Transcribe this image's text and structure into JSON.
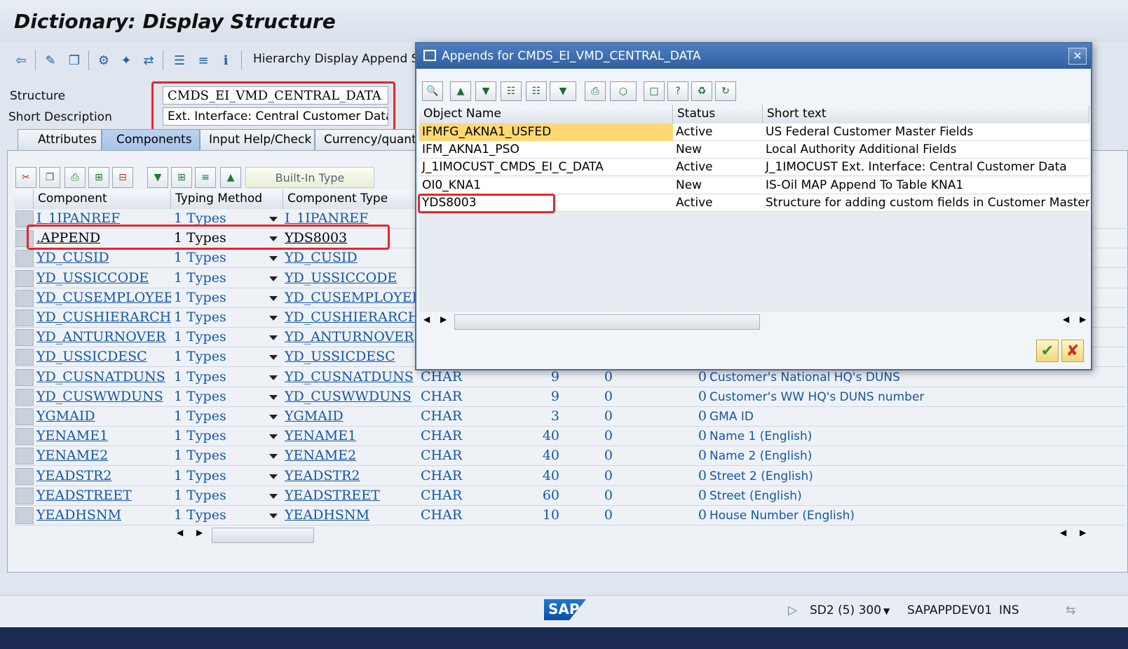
{
  "window": {
    "title": "Dictionary: Display Structure"
  },
  "toolbar": {
    "hierarchy_display": "Hierarchy Display",
    "append_structures": "Append S"
  },
  "header": {
    "structure_label": "Structure",
    "structure_value": "CMDS_EI_VMD_CENTRAL_DATA",
    "short_desc_label": "Short Description",
    "short_desc_value": "Ext. Interface: Central Customer Data"
  },
  "tabs": [
    "Attributes",
    "Components",
    "Input Help/Check",
    "Currency/quantit"
  ],
  "table_toolbar": {
    "builtin_type": "Built-In Type"
  },
  "grid": {
    "columns": [
      "Component",
      "Typing Method",
      "Component Type"
    ],
    "rows": [
      {
        "component": "I_1IPANREF",
        "typing": "1 Types",
        "ctype": "I_1IPANREF",
        "dtype": "",
        "length": "",
        "dec": "",
        "short": "",
        "desc": ""
      },
      {
        "component": ".APPEND",
        "typing": "1 Types",
        "ctype": "YDS8003",
        "dtype": "",
        "length": "",
        "dec": "",
        "short": "",
        "desc": ""
      },
      {
        "component": "YD_CUSID",
        "typing": "1 Types",
        "ctype": "YD_CUSID",
        "dtype": "",
        "length": "",
        "dec": "",
        "short": "",
        "desc": ""
      },
      {
        "component": "YD_USSICCODE",
        "typing": "1 Types",
        "ctype": "YD_USSICCODE",
        "dtype": "",
        "length": "",
        "dec": "",
        "short": "",
        "desc": ""
      },
      {
        "component": "YD_CUSEMPLOYEE",
        "typing": "1 Types",
        "ctype": "YD_CUSEMPLOYEE",
        "dtype": "",
        "length": "",
        "dec": "",
        "short": "",
        "desc": ""
      },
      {
        "component": "YD_CUSHIERARCHY",
        "typing": "1 Types",
        "ctype": "YD_CUSHIERARCHY",
        "dtype": "",
        "length": "",
        "dec": "",
        "short": "",
        "desc": ""
      },
      {
        "component": "YD_ANTURNOVER",
        "typing": "1 Types",
        "ctype": "YD_ANTURNOVER",
        "dtype": "",
        "length": "",
        "dec": "",
        "short": "",
        "desc": ""
      },
      {
        "component": "YD_USSICDESC",
        "typing": "1 Types",
        "ctype": "YD_USSICDESC",
        "dtype": "",
        "length": "",
        "dec": "",
        "short": "",
        "desc": ""
      },
      {
        "component": "YD_CUSNATDUNS",
        "typing": "1 Types",
        "ctype": "YD_CUSNATDUNS",
        "dtype": "CHAR",
        "length": "9",
        "dec": "0",
        "short": "0",
        "desc": "Customer's National HQ's DUNS"
      },
      {
        "component": "YD_CUSWWDUNS",
        "typing": "1 Types",
        "ctype": "YD_CUSWWDUNS",
        "dtype": "CHAR",
        "length": "9",
        "dec": "0",
        "short": "0",
        "desc": "Customer's WW HQ's DUNS number"
      },
      {
        "component": "YGMAID",
        "typing": "1 Types",
        "ctype": "YGMAID",
        "dtype": "CHAR",
        "length": "3",
        "dec": "0",
        "short": "0",
        "desc": "GMA ID"
      },
      {
        "component": "YENAME1",
        "typing": "1 Types",
        "ctype": "YENAME1",
        "dtype": "CHAR",
        "length": "40",
        "dec": "0",
        "short": "0",
        "desc": "Name 1 (English)"
      },
      {
        "component": "YENAME2",
        "typing": "1 Types",
        "ctype": "YENAME2",
        "dtype": "CHAR",
        "length": "40",
        "dec": "0",
        "short": "0",
        "desc": "Name 2 (English)"
      },
      {
        "component": "YEADSTR2",
        "typing": "1 Types",
        "ctype": "YEADSTR2",
        "dtype": "CHAR",
        "length": "40",
        "dec": "0",
        "short": "0",
        "desc": "Street 2 (English)"
      },
      {
        "component": "YEADSTREET",
        "typing": "1 Types",
        "ctype": "YEADSTREET",
        "dtype": "CHAR",
        "length": "60",
        "dec": "0",
        "short": "0",
        "desc": "Street (English)"
      },
      {
        "component": "YEADHSNM",
        "typing": "1 Types",
        "ctype": "YEADHSNM",
        "dtype": "CHAR",
        "length": "10",
        "dec": "0",
        "short": "0",
        "desc": "House Number (English)"
      }
    ]
  },
  "dialog": {
    "title": "Appends for CMDS_EI_VMD_CENTRAL_DATA",
    "columns": [
      "Object Name",
      "Status",
      "Short text"
    ],
    "rows": [
      {
        "name": "IFMFG_AKNA1_USFED",
        "status": "Active",
        "text": "US Federal Customer Master Fields"
      },
      {
        "name": "IFM_AKNA1_PSO",
        "status": "New",
        "text": "Local Authority Additional Fields"
      },
      {
        "name": "J_1IMOCUST_CMDS_EI_C_DATA",
        "status": "Active",
        "text": "J_1IMOCUST Ext. Interface: Central Customer Data"
      },
      {
        "name": "OI0_KNA1",
        "status": "New",
        "text": "IS-Oil MAP Append To Table KNA1"
      },
      {
        "name": "YDS8003",
        "status": "Active",
        "text": "Structure for adding custom fields in Customer Master"
      }
    ],
    "confirm_icon": "checkmark-icon",
    "cancel_icon": "cancel-icon"
  },
  "statusbar": {
    "logo": "SAP",
    "system": "SD2 (5) 300",
    "server": "SAPAPPDEV01",
    "mode": "INS"
  },
  "colors": {
    "highlight_red": "#e8262a",
    "selected_row": "#ffd873",
    "title_blue": "#2f5f9f",
    "link_blue": "#1356a8"
  }
}
